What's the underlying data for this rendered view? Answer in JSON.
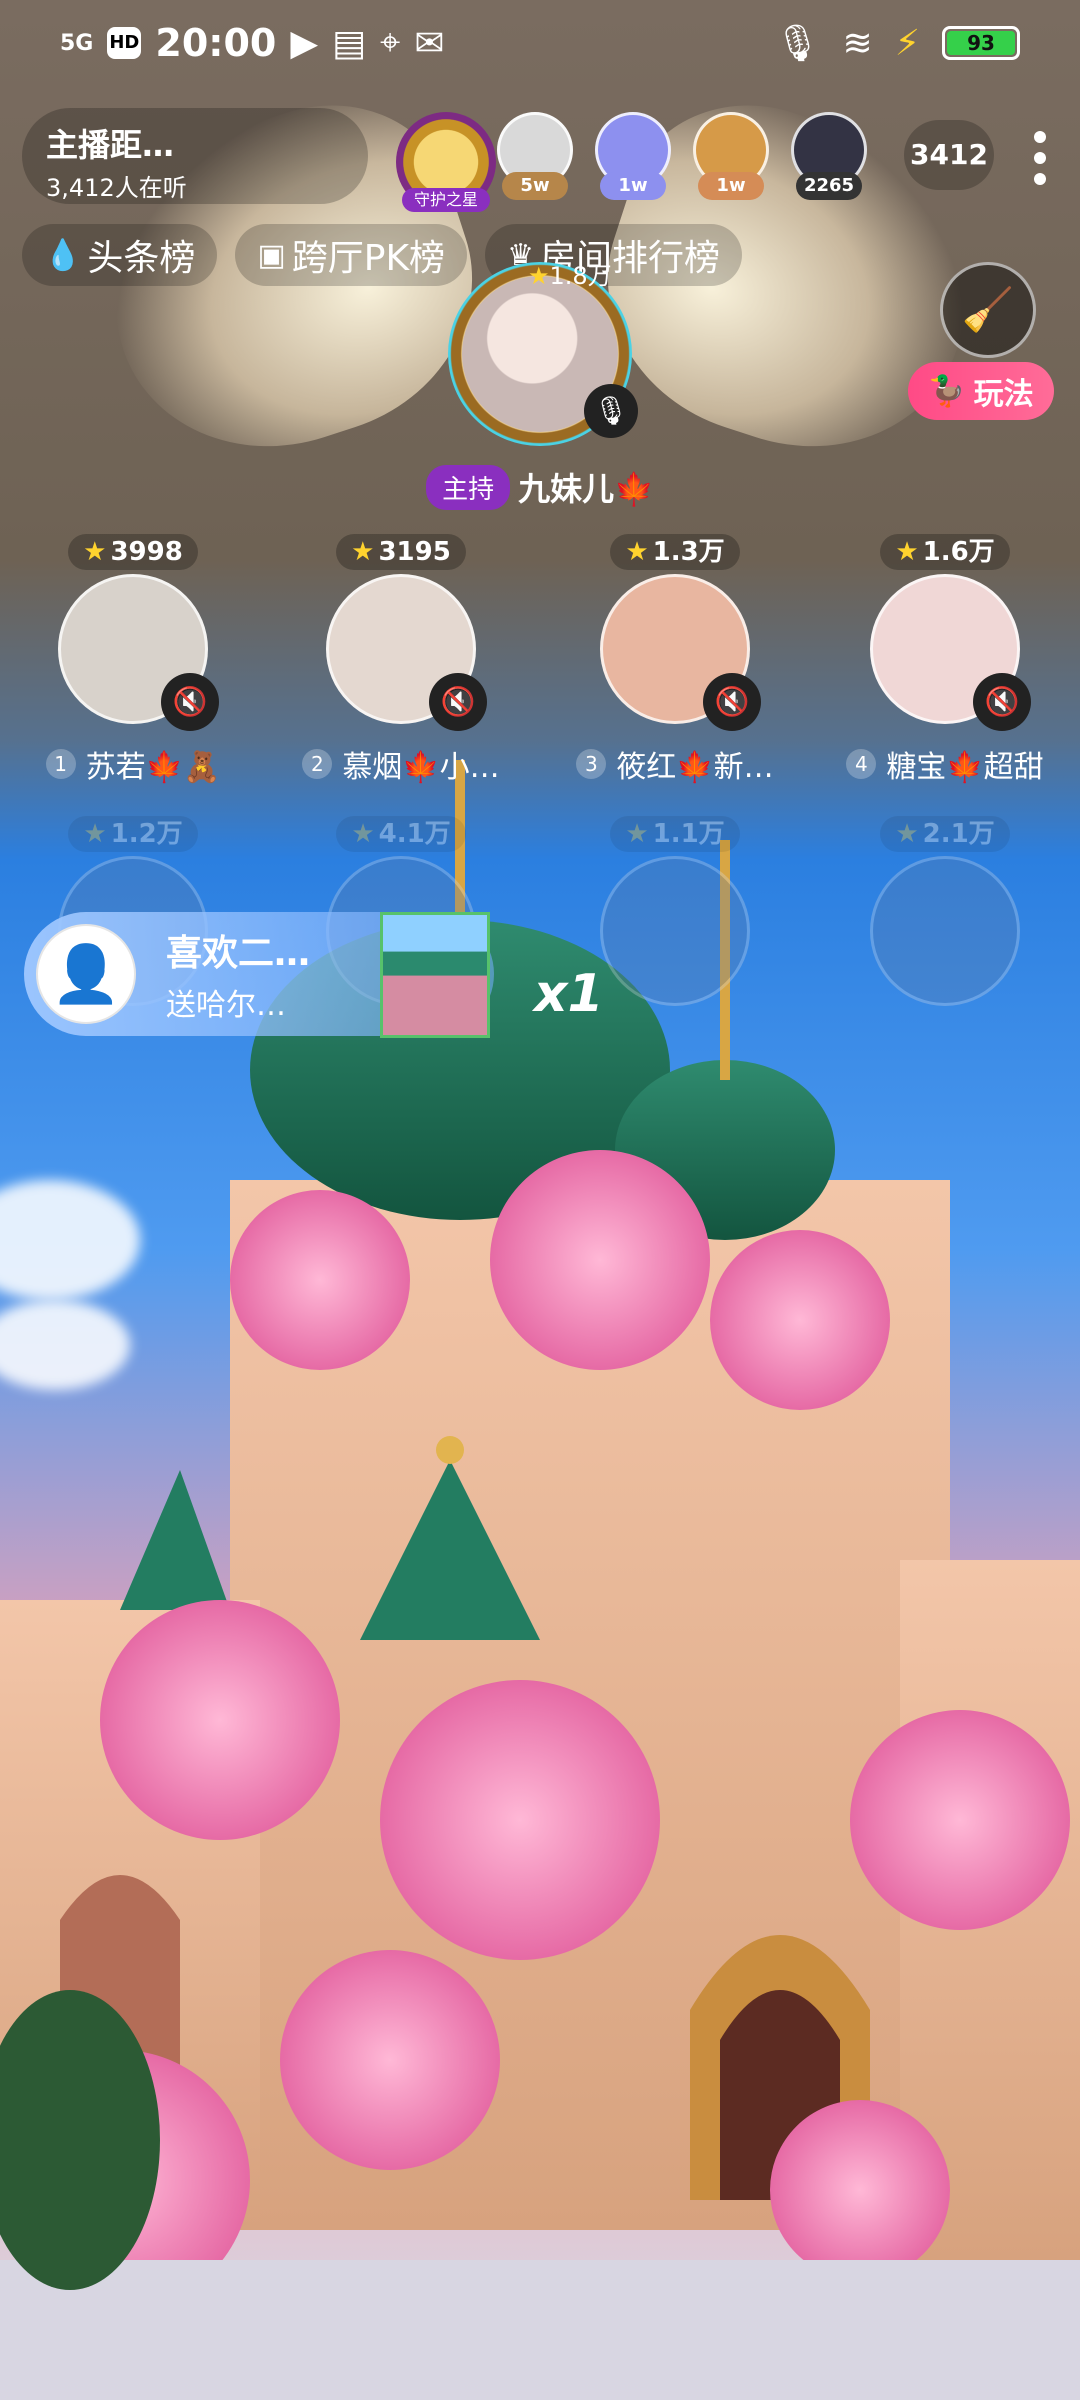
{
  "status_bar": {
    "network": "5G",
    "hd": "HD",
    "time": "20:00",
    "battery": "93"
  },
  "host_card": {
    "title": "主播距…",
    "listeners": "3,412人在听"
  },
  "top_contributors": [
    {
      "badge": "守护之星",
      "badge_color": "#8a2fbf"
    },
    {
      "badge": "5w",
      "badge_color": "#b6864a"
    },
    {
      "badge": "1w",
      "badge_color": "#8d90ef"
    },
    {
      "badge": "1w",
      "badge_color": "#d58c56"
    },
    {
      "badge": "2265",
      "badge_color": "#333333"
    }
  ],
  "audience_count": "3412",
  "rank_tabs": [
    {
      "icon": "💧",
      "label": "头条榜"
    },
    {
      "icon": "▣",
      "label": "跨厅PK榜"
    },
    {
      "icon": "♛",
      "label": "房间排行榜"
    }
  ],
  "play_button": {
    "label": "玩法"
  },
  "host": {
    "score": "1.8万",
    "role": "主持",
    "name": "九妹儿🍁"
  },
  "seats": [
    {
      "index": "1",
      "score": "3998",
      "name": "苏若🍁🧸"
    },
    {
      "index": "2",
      "score": "3195",
      "name": "慕烟🍁小…"
    },
    {
      "index": "3",
      "score": "1.3万",
      "name": "筱红🍁新…"
    },
    {
      "index": "4",
      "score": "1.6万",
      "name": "糖宝🍁超甜"
    }
  ],
  "ghost_seats": [
    {
      "score": "1.2万"
    },
    {
      "score": "4.1万"
    },
    {
      "score": "1.1万"
    },
    {
      "score": "2.1万"
    }
  ],
  "gift_banner": {
    "sender": "喜欢二…",
    "action": "送哈尔…",
    "count": "x1"
  },
  "colors": {
    "accent_pink": "#ff4a86",
    "role_purple": "#8a2fbf",
    "score_star": "#ffd32e"
  }
}
